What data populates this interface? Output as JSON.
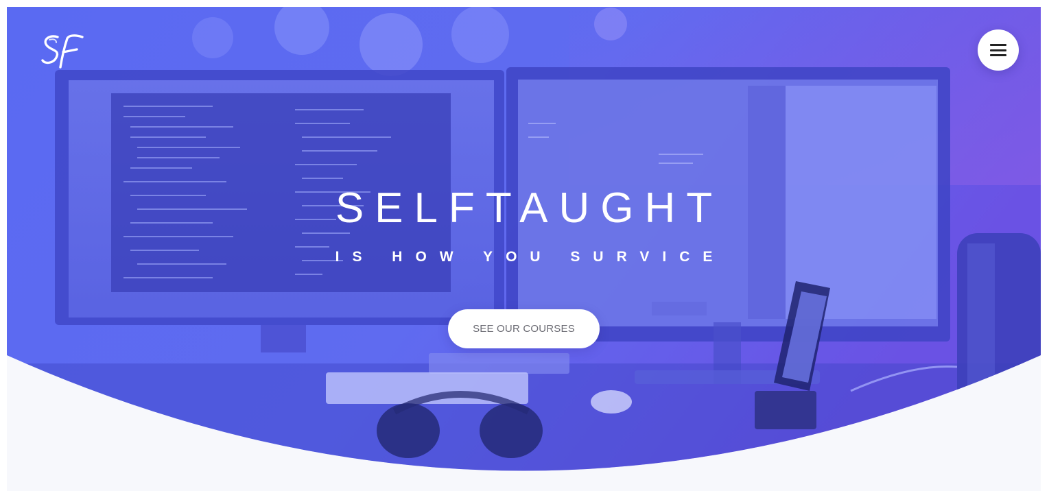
{
  "brand": {
    "logo_text": "SF",
    "logo_icon": "sf-monogram-logo"
  },
  "nav": {
    "menu_icon": "hamburger-menu-icon"
  },
  "hero": {
    "title": "SELFTAUGHT",
    "tagline": "IS HOW YOU SURVICE",
    "cta_label": "SEE OUR COURSES",
    "background_image": "desk-with-dual-monitors-keyboard-headphones-phone-photo",
    "overlay_colors": {
      "left": "#5a6cf4",
      "right": "#6a4fe6",
      "top_right": "#7b5ee6"
    }
  },
  "colors": {
    "page_background": "#f7f8fc",
    "button_background": "#ffffff",
    "button_text": "#6a6a72",
    "hero_text": "#ffffff"
  }
}
